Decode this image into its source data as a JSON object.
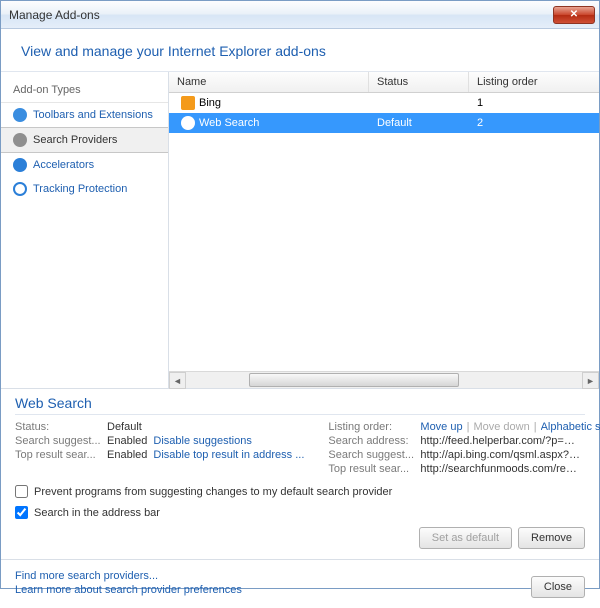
{
  "window": {
    "title": "Manage Add-ons"
  },
  "header": {
    "title": "View and manage your Internet Explorer add-ons"
  },
  "sidebar": {
    "heading": "Add-on Types",
    "items": [
      {
        "label": "Toolbars and Extensions",
        "icon_color": "#3a8de0"
      },
      {
        "label": "Search Providers",
        "icon_color": "#8f8f8f",
        "selected": true
      },
      {
        "label": "Accelerators",
        "icon_color": "#2b7fd8"
      },
      {
        "label": "Tracking Protection",
        "icon_color": "#2b7fd8"
      }
    ]
  },
  "list": {
    "columns": {
      "name": "Name",
      "status": "Status",
      "order": "Listing order"
    },
    "rows": [
      {
        "name": "Bing",
        "status": "",
        "order": "1",
        "icon_color": "#f49a1a",
        "selected": false
      },
      {
        "name": "Web Search",
        "status": "Default",
        "order": "2",
        "icon_color": "#ffffff",
        "selected": true
      }
    ]
  },
  "details": {
    "title": "Web Search",
    "left": {
      "status": {
        "label": "Status:",
        "value": "Default"
      },
      "suggest": {
        "label": "Search suggest...",
        "value": "Enabled",
        "link": "Disable suggestions"
      },
      "top": {
        "label": "Top result sear...",
        "value": "Enabled",
        "link": "Disable top result in address ..."
      }
    },
    "right": {
      "order_label": "Listing order:",
      "move_up": "Move up",
      "move_down": "Move down",
      "alpha": "Alphabetic sort",
      "addr": {
        "label": "Search address:",
        "value": "http://feed.helperbar.com/?p=mKO_..."
      },
      "sugg": {
        "label": "Search suggest...",
        "value": "http://api.bing.com/qsml.aspx?query..."
      },
      "topr": {
        "label": "Top result sear...",
        "value": "http://searchfunmoods.com/results.p..."
      }
    },
    "checkboxes": {
      "prevent": {
        "label": "Prevent programs from suggesting changes to my default search provider",
        "checked": false
      },
      "addressbar": {
        "label": "Search in the address bar",
        "checked": true
      }
    },
    "buttons": {
      "set_default": "Set as default",
      "remove": "Remove"
    }
  },
  "footer": {
    "links": {
      "find": "Find more search providers...",
      "learn": "Learn more about search provider preferences"
    },
    "close": "Close"
  }
}
